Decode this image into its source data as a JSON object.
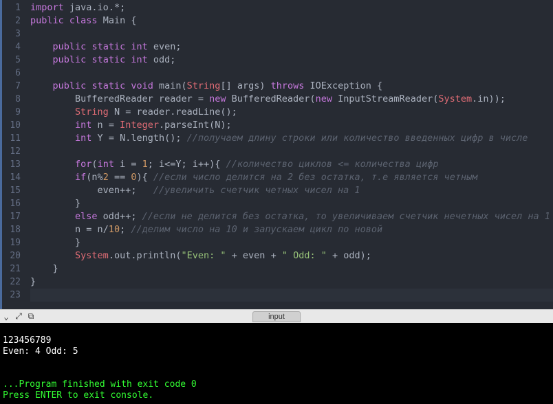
{
  "editor": {
    "lines": [
      {
        "num": 1,
        "fold": "",
        "tokens": [
          {
            "t": "import ",
            "c": "kw"
          },
          {
            "t": "java.io.",
            "c": "pln"
          },
          {
            "t": "*",
            "c": "star"
          },
          {
            "t": ";",
            "c": "pln"
          }
        ]
      },
      {
        "num": 2,
        "fold": "▾",
        "tokens": [
          {
            "t": "public",
            "c": "kw"
          },
          {
            "t": " ",
            "c": "pln"
          },
          {
            "t": "class",
            "c": "kw"
          },
          {
            "t": " ",
            "c": "pln"
          },
          {
            "t": "Main",
            "c": "ident"
          },
          {
            "t": " {",
            "c": "brace"
          }
        ]
      },
      {
        "num": 3,
        "fold": "",
        "tokens": []
      },
      {
        "num": 4,
        "fold": "",
        "tokens": [
          {
            "t": "    ",
            "c": "pln"
          },
          {
            "t": "public",
            "c": "kw"
          },
          {
            "t": " ",
            "c": "pln"
          },
          {
            "t": "static",
            "c": "kw"
          },
          {
            "t": " ",
            "c": "pln"
          },
          {
            "t": "int",
            "c": "type2"
          },
          {
            "t": " even;",
            "c": "pln"
          }
        ]
      },
      {
        "num": 5,
        "fold": "",
        "tokens": [
          {
            "t": "    ",
            "c": "pln"
          },
          {
            "t": "public",
            "c": "kw"
          },
          {
            "t": " ",
            "c": "pln"
          },
          {
            "t": "static",
            "c": "kw"
          },
          {
            "t": " ",
            "c": "pln"
          },
          {
            "t": "int",
            "c": "type2"
          },
          {
            "t": " odd;",
            "c": "pln"
          }
        ]
      },
      {
        "num": 6,
        "fold": "",
        "tokens": []
      },
      {
        "num": 7,
        "fold": "▾",
        "tokens": [
          {
            "t": "    ",
            "c": "pln"
          },
          {
            "t": "public",
            "c": "kw"
          },
          {
            "t": " ",
            "c": "pln"
          },
          {
            "t": "static",
            "c": "kw"
          },
          {
            "t": " ",
            "c": "pln"
          },
          {
            "t": "void",
            "c": "type2"
          },
          {
            "t": " main(",
            "c": "pln"
          },
          {
            "t": "String",
            "c": "type"
          },
          {
            "t": "[] args) ",
            "c": "pln"
          },
          {
            "t": "throws",
            "c": "kw"
          },
          {
            "t": " ",
            "c": "pln"
          },
          {
            "t": "IOException",
            "c": "cls2"
          },
          {
            "t": " {",
            "c": "brace"
          }
        ]
      },
      {
        "num": 8,
        "fold": "",
        "tokens": [
          {
            "t": "        BufferedReader reader ",
            "c": "pln"
          },
          {
            "t": "=",
            "c": "op"
          },
          {
            "t": " ",
            "c": "pln"
          },
          {
            "t": "new",
            "c": "kw"
          },
          {
            "t": " BufferedReader(",
            "c": "pln"
          },
          {
            "t": "new",
            "c": "kw"
          },
          {
            "t": " InputStreamReader(",
            "c": "pln"
          },
          {
            "t": "System",
            "c": "type"
          },
          {
            "t": ".in));",
            "c": "pln"
          }
        ]
      },
      {
        "num": 9,
        "fold": "",
        "tokens": [
          {
            "t": "        ",
            "c": "pln"
          },
          {
            "t": "String",
            "c": "type"
          },
          {
            "t": " N ",
            "c": "pln"
          },
          {
            "t": "=",
            "c": "op"
          },
          {
            "t": " reader.readLine();",
            "c": "pln"
          }
        ]
      },
      {
        "num": 10,
        "fold": "",
        "tokens": [
          {
            "t": "        ",
            "c": "pln"
          },
          {
            "t": "int",
            "c": "type2"
          },
          {
            "t": " n ",
            "c": "pln"
          },
          {
            "t": "=",
            "c": "op"
          },
          {
            "t": " ",
            "c": "pln"
          },
          {
            "t": "Integer",
            "c": "type"
          },
          {
            "t": ".parseInt(N);",
            "c": "pln"
          }
        ]
      },
      {
        "num": 11,
        "fold": "",
        "tokens": [
          {
            "t": "        ",
            "c": "pln"
          },
          {
            "t": "int",
            "c": "type2"
          },
          {
            "t": " Y ",
            "c": "pln"
          },
          {
            "t": "=",
            "c": "op"
          },
          {
            "t": " N.length(); ",
            "c": "pln"
          },
          {
            "t": "//получаем длину строки или количество введенных цифр в числе",
            "c": "com"
          }
        ]
      },
      {
        "num": 12,
        "fold": "",
        "tokens": []
      },
      {
        "num": 13,
        "fold": "▾",
        "tokens": [
          {
            "t": "        ",
            "c": "pln"
          },
          {
            "t": "for",
            "c": "kw"
          },
          {
            "t": "(",
            "c": "pln"
          },
          {
            "t": "int",
            "c": "type2"
          },
          {
            "t": " i ",
            "c": "pln"
          },
          {
            "t": "=",
            "c": "op"
          },
          {
            "t": " ",
            "c": "pln"
          },
          {
            "t": "1",
            "c": "num"
          },
          {
            "t": "; i",
            "c": "pln"
          },
          {
            "t": "<=",
            "c": "op"
          },
          {
            "t": "Y; i",
            "c": "pln"
          },
          {
            "t": "++",
            "c": "op"
          },
          {
            "t": "){ ",
            "c": "pln"
          },
          {
            "t": "//количество циклов <= количества цифр",
            "c": "com"
          }
        ]
      },
      {
        "num": 14,
        "fold": "▾",
        "tokens": [
          {
            "t": "        ",
            "c": "pln"
          },
          {
            "t": "if",
            "c": "kw"
          },
          {
            "t": "(n",
            "c": "pln"
          },
          {
            "t": "%",
            "c": "op"
          },
          {
            "t": "2",
            "c": "num"
          },
          {
            "t": " ",
            "c": "pln"
          },
          {
            "t": "==",
            "c": "op"
          },
          {
            "t": " ",
            "c": "pln"
          },
          {
            "t": "0",
            "c": "num"
          },
          {
            "t": "){ ",
            "c": "pln"
          },
          {
            "t": "//если число делится на 2 без остатка, т.е является четным",
            "c": "com"
          }
        ]
      },
      {
        "num": 15,
        "fold": "",
        "tokens": [
          {
            "t": "            even",
            "c": "pln"
          },
          {
            "t": "++",
            "c": "op"
          },
          {
            "t": ";   ",
            "c": "pln"
          },
          {
            "t": "//увеличить счетчик четных чисел на 1",
            "c": "com"
          }
        ]
      },
      {
        "num": 16,
        "fold": "",
        "tokens": [
          {
            "t": "        }",
            "c": "brace"
          }
        ]
      },
      {
        "num": 17,
        "fold": "",
        "tokens": [
          {
            "t": "        ",
            "c": "pln"
          },
          {
            "t": "else",
            "c": "kw"
          },
          {
            "t": " odd",
            "c": "pln"
          },
          {
            "t": "++",
            "c": "op"
          },
          {
            "t": "; ",
            "c": "pln"
          },
          {
            "t": "//если не делится без остатка, то увеличиваем счетчик нечетных чисел на 1",
            "c": "com"
          }
        ]
      },
      {
        "num": 18,
        "fold": "",
        "tokens": [
          {
            "t": "        n ",
            "c": "pln"
          },
          {
            "t": "=",
            "c": "op"
          },
          {
            "t": " n",
            "c": "pln"
          },
          {
            "t": "/",
            "c": "op"
          },
          {
            "t": "10",
            "c": "num"
          },
          {
            "t": "; ",
            "c": "pln"
          },
          {
            "t": "//делим число на 10 и запускаем цикл по новой",
            "c": "com"
          }
        ]
      },
      {
        "num": 19,
        "fold": "",
        "tokens": [
          {
            "t": "        }",
            "c": "brace"
          }
        ]
      },
      {
        "num": 20,
        "fold": "",
        "tokens": [
          {
            "t": "        ",
            "c": "pln"
          },
          {
            "t": "System",
            "c": "type"
          },
          {
            "t": ".out.println(",
            "c": "pln"
          },
          {
            "t": "\"Even: \"",
            "c": "str"
          },
          {
            "t": " ",
            "c": "pln"
          },
          {
            "t": "+",
            "c": "op"
          },
          {
            "t": " even ",
            "c": "pln"
          },
          {
            "t": "+",
            "c": "op"
          },
          {
            "t": " ",
            "c": "pln"
          },
          {
            "t": "\" Odd: \"",
            "c": "str"
          },
          {
            "t": " ",
            "c": "pln"
          },
          {
            "t": "+",
            "c": "op"
          },
          {
            "t": " odd);",
            "c": "pln"
          }
        ]
      },
      {
        "num": 21,
        "fold": "",
        "tokens": [
          {
            "t": "    }",
            "c": "brace"
          }
        ]
      },
      {
        "num": 22,
        "fold": "",
        "tokens": [
          {
            "t": "}",
            "c": "brace"
          }
        ]
      },
      {
        "num": 23,
        "fold": "",
        "cur": true,
        "tokens": []
      }
    ]
  },
  "toolbar": {
    "icons": [
      {
        "name": "undo-icon",
        "glyph": "⌄"
      },
      {
        "name": "expand-icon",
        "glyph": "⤢"
      },
      {
        "name": "copy-icon",
        "glyph": "⧉"
      }
    ],
    "tab": "input"
  },
  "console": {
    "line1": "123456789",
    "line2": "Even: 4 Odd: 5",
    "blank": "",
    "msg1": "...Program finished with exit code 0",
    "msg2": "Press ENTER to exit console."
  }
}
